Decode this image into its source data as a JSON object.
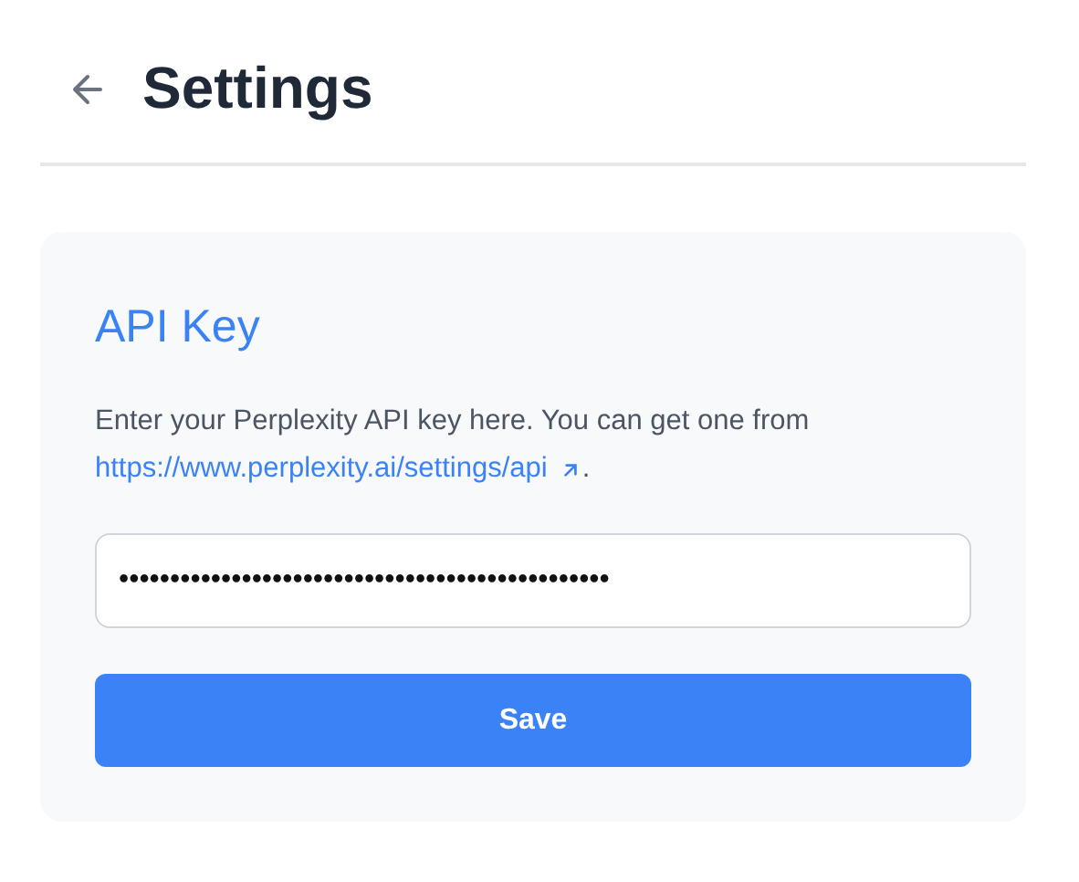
{
  "header": {
    "title": "Settings"
  },
  "card": {
    "title": "API Key",
    "description": "Enter your Perplexity API key here. You can get one from",
    "link": "https://www.perplexity.ai/settings/api",
    "after_link": ".",
    "field": {
      "value": "••••••••••••••••••••••••••••••••••••••••••••••••"
    },
    "button": "Save"
  }
}
